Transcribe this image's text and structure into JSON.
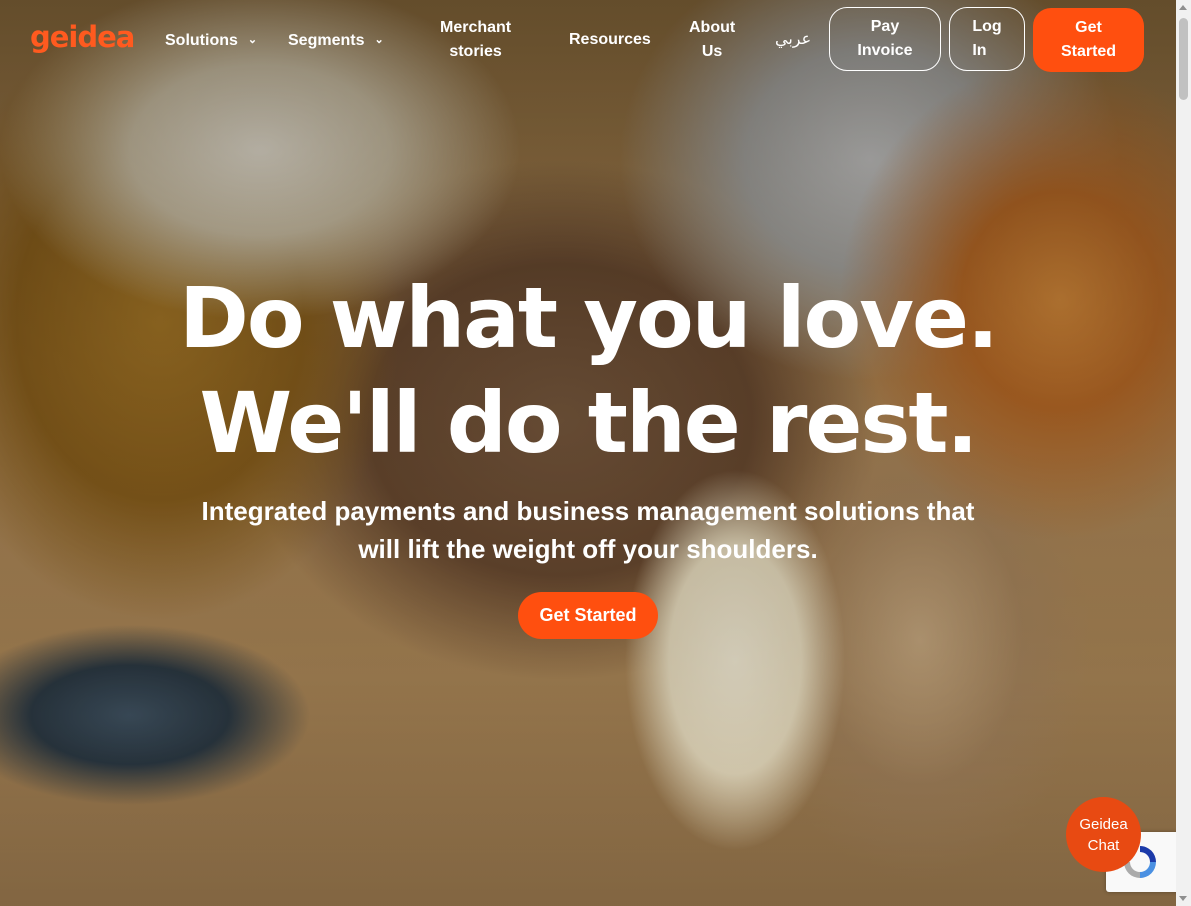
{
  "nav": {
    "logo": "geidea",
    "items": [
      {
        "label": "Solutions",
        "has_dropdown": true
      },
      {
        "label": "Segments",
        "has_dropdown": true
      },
      {
        "label_line1": "Merchant",
        "label_line2": "stories"
      },
      {
        "label": "Resources"
      },
      {
        "label_line1": "About",
        "label_line2": "Us"
      },
      {
        "label": "عربي"
      }
    ],
    "pay_invoice_line1": "Pay",
    "pay_invoice_line2": "Invoice",
    "login_line1": "Log",
    "login_line2": "In",
    "get_started_line1": "Get",
    "get_started_line2": "Started"
  },
  "hero": {
    "headline_line1": "Do what you love.",
    "headline_line2": "We'll do the rest.",
    "subheadline": "Integrated payments and business management solutions that will lift the weight off your shoulders.",
    "cta_label": "Get Started"
  },
  "chat": {
    "line1": "Geidea",
    "line2": "Chat"
  },
  "colors": {
    "brand": "#ff4f0f"
  }
}
